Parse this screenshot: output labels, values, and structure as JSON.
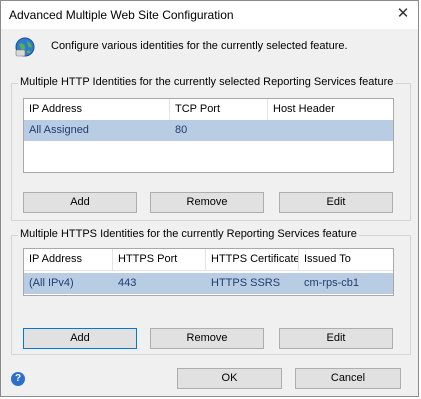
{
  "window": {
    "title": "Advanced Multiple Web Site Configuration",
    "close_glyph": "✕"
  },
  "header": {
    "icon": "globe-icon",
    "text": "Configure various identities for the currently selected feature."
  },
  "http_group": {
    "legend": "Multiple HTTP Identities for the currently selected Reporting Services feature",
    "columns": [
      "IP Address",
      "TCP Port",
      "Host Header"
    ],
    "rows": [
      {
        "ip": "All Assigned",
        "port": "80",
        "host": ""
      }
    ],
    "buttons": {
      "add": "Add",
      "remove": "Remove",
      "edit": "Edit"
    }
  },
  "https_group": {
    "legend": "Multiple HTTPS Identities for the currently Reporting Services feature",
    "columns": [
      "IP Address",
      "HTTPS Port",
      "HTTPS Certificate",
      "Issued To"
    ],
    "rows": [
      {
        "ip": "(All IPv4)",
        "port": "443",
        "cert": "HTTPS SSRS",
        "issued": "cm-rps-cb1"
      }
    ],
    "buttons": {
      "add": "Add",
      "remove": "Remove",
      "edit": "Edit"
    }
  },
  "footer": {
    "help_glyph": "?",
    "ok": "OK",
    "cancel": "Cancel"
  },
  "colors": {
    "selection": "#b8cce4",
    "accent": "#0078d7"
  }
}
